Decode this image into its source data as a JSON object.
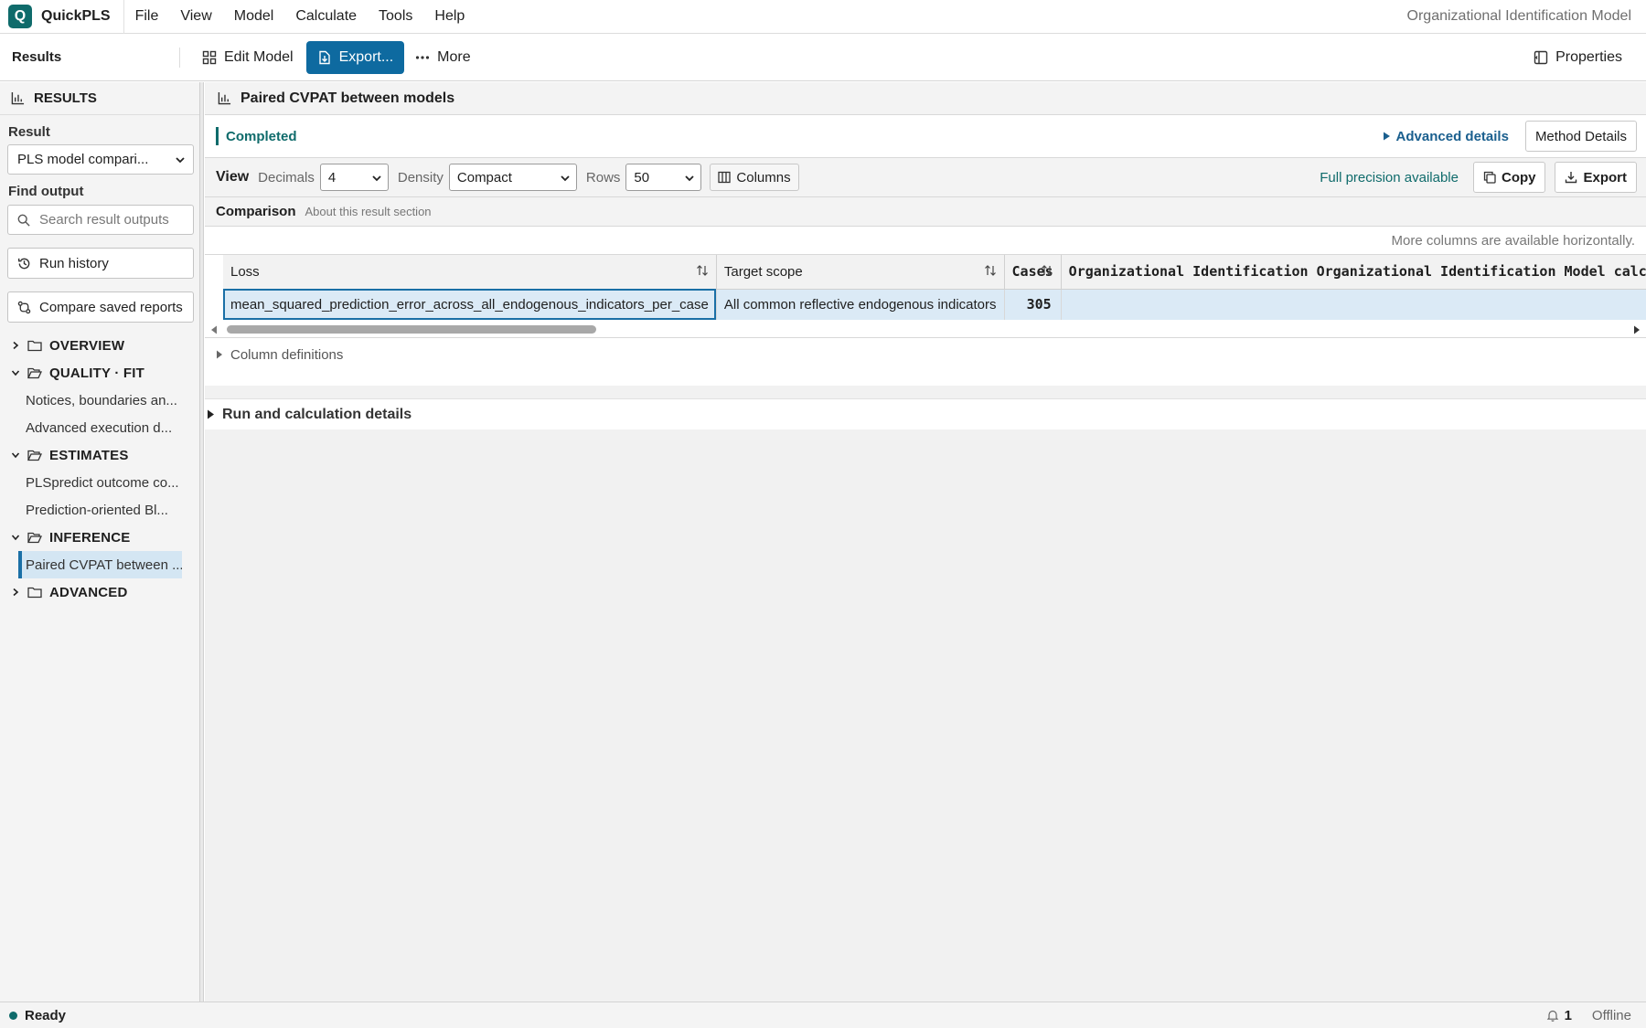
{
  "app": {
    "logo_letter": "Q",
    "name": "QuickPLS",
    "document_title": "Organizational Identification Model"
  },
  "menu": [
    "File",
    "View",
    "Model",
    "Calculate",
    "Tools",
    "Help"
  ],
  "toolbar": {
    "section": "Results",
    "edit_model": "Edit Model",
    "export": "Export...",
    "more": "More",
    "properties": "Properties"
  },
  "sidebar": {
    "title": "RESULTS",
    "result_label": "Result",
    "result_value": "PLS model compari...",
    "find_label": "Find output",
    "find_placeholder": "Search result outputs",
    "run_history": "Run history",
    "compare_reports": "Compare saved reports",
    "groups": {
      "overview": "OVERVIEW",
      "quality": "QUALITY · FIT",
      "quality_items": [
        "Notices, boundaries an...",
        "Advanced execution d..."
      ],
      "estimates": "ESTIMATES",
      "estimates_items": [
        "PLSpredict outcome co...",
        "Prediction-oriented Bl..."
      ],
      "inference": "INFERENCE",
      "inference_items": [
        "Paired CVPAT between ..."
      ],
      "advanced": "ADVANCED"
    }
  },
  "main": {
    "title": "Paired CVPAT between models",
    "status": "Completed",
    "advanced_details": "Advanced details",
    "method_details": "Method Details",
    "view": {
      "label": "View",
      "decimals_label": "Decimals",
      "decimals_value": "4",
      "density_label": "Density",
      "density_value": "Compact",
      "rows_label": "Rows",
      "rows_value": "50",
      "columns_btn": "Columns",
      "precision_note": "Full precision available",
      "copy": "Copy",
      "export": "Export"
    },
    "section_title": "Comparison",
    "section_about": "About this result section",
    "more_columns_note": "More columns are available horizontally.",
    "table": {
      "headers": [
        "Loss",
        "Target scope",
        "Cases",
        "Organizational Identification Organizational Identification Model calcu"
      ],
      "row": [
        "mean_squared_prediction_error_across_all_endogenous_indicators_per_case",
        "All common reflective endogenous indicators",
        "305",
        ""
      ]
    },
    "column_definitions": "Column definitions",
    "run_details": "Run and calculation details"
  },
  "statusbar": {
    "ready": "Ready",
    "notifications": "1",
    "connection": "Offline"
  },
  "colors": {
    "brand": "#0f6b6b",
    "primary_button": "#0e6aa0",
    "selection": "#d4e6f3"
  }
}
